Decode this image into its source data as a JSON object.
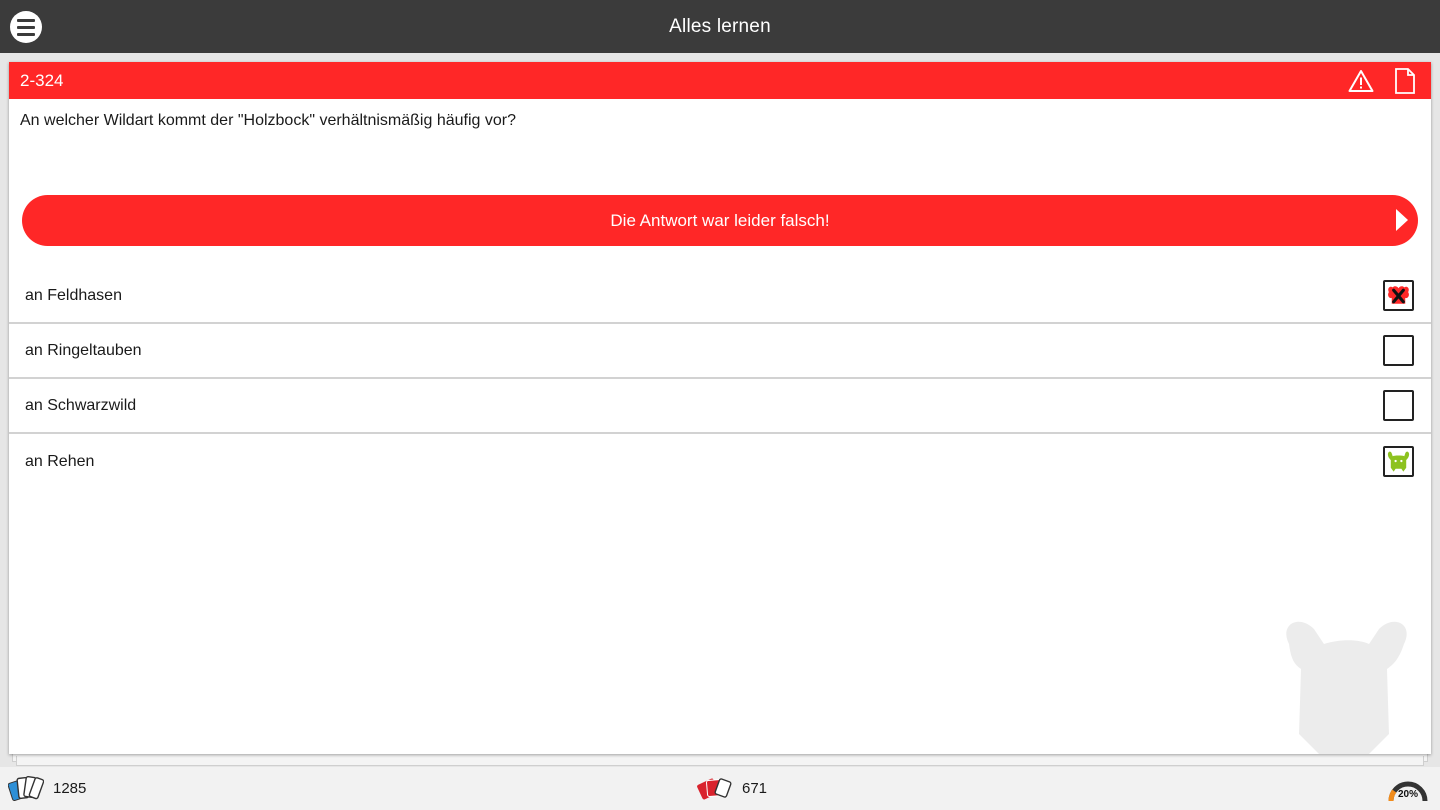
{
  "header": {
    "title": "Alles lernen"
  },
  "card": {
    "id": "2-324",
    "question": "An welcher Wildart kommt der \"Holzbock\" verhältnismäßig häufig vor?",
    "result": "Die Antwort war leider falsch!",
    "accent_color": "#ff2727",
    "answers": [
      {
        "label": "an Feldhasen",
        "state": "wrong-selected"
      },
      {
        "label": "an Ringeltauben",
        "state": "empty"
      },
      {
        "label": "an Schwarzwild",
        "state": "empty"
      },
      {
        "label": "an Rehen",
        "state": "correct"
      }
    ]
  },
  "footer": {
    "total_count": "1285",
    "wrong_count": "671",
    "progress_label": "20%",
    "progress": 0.2
  },
  "icons": {
    "menu": "hamburger-menu-icon",
    "warning": "warning-triangle-icon",
    "note": "note-page-icon",
    "cards": "card-stack-icon",
    "wrong_cards": "wrong-cards-icon",
    "gauge": "progress-gauge-icon"
  }
}
